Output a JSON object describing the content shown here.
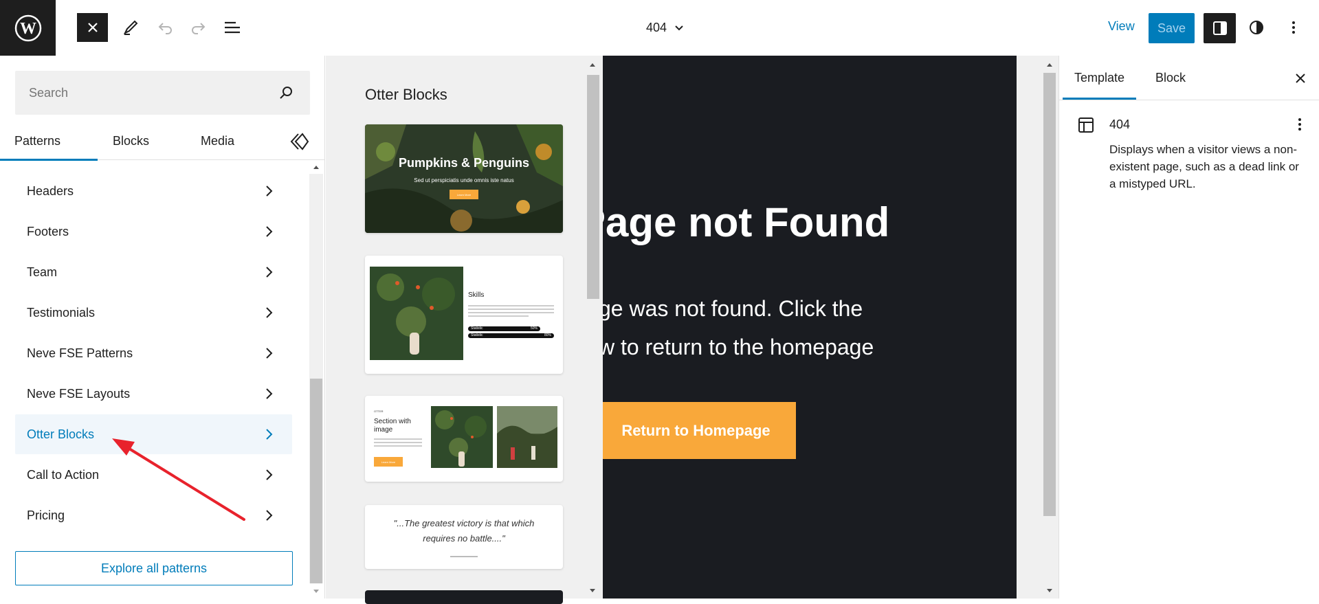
{
  "toolbar": {
    "document_title": "404",
    "view_label": "View",
    "save_label": "Save"
  },
  "inserter": {
    "search_placeholder": "Search",
    "tabs": [
      "Patterns",
      "Blocks",
      "Media"
    ],
    "categories": [
      {
        "label": "Headers"
      },
      {
        "label": "Footers"
      },
      {
        "label": "Team"
      },
      {
        "label": "Testimonials"
      },
      {
        "label": "Neve FSE Patterns"
      },
      {
        "label": "Neve FSE Layouts"
      },
      {
        "label": "Otter Blocks",
        "active": true
      },
      {
        "label": "Call to Action"
      },
      {
        "label": "Pricing"
      }
    ],
    "explore_label": "Explore all patterns"
  },
  "preview": {
    "title": "Otter Blocks",
    "pattern1": {
      "heading": "Pumpkins & Penguins",
      "sub": "Sed ut perspiciatis unde omnis iste natus",
      "button": "Learn More"
    },
    "pattern2": {
      "heading": "Skills",
      "bar1": "Statistic",
      "bar1_value": "50%",
      "bar2": "Statistic",
      "bar2_value": "80%"
    },
    "pattern3": {
      "kicker": "OTTER",
      "heading": "Section with image",
      "button": "Learn More"
    },
    "pattern4": {
      "quote": "\"...The greatest victory is that which requires no battle....\""
    }
  },
  "canvas": {
    "heading": "Page not Found",
    "line1": "ge was not found. Click the",
    "line2": "w to return to the homepage",
    "button": "Return to Homepage"
  },
  "sidebar": {
    "tabs": [
      "Template",
      "Block"
    ],
    "template_title": "404",
    "template_desc": "Displays when a visitor views a non-existent page, such as a dead link or a mistyped URL."
  },
  "colors": {
    "accent": "#007cba",
    "canvas_bg": "#1a1c21",
    "cta": "#f9a83a",
    "annotation_arrow": "#e8222c"
  }
}
